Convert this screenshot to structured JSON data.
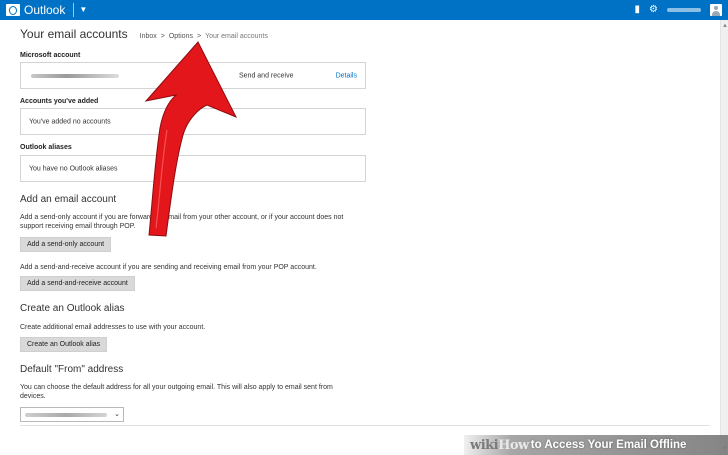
{
  "topbar": {
    "brand": "Outlook",
    "icons": [
      "chat-icon",
      "gear-icon",
      "avatar"
    ],
    "color": "#0072c6"
  },
  "page": {
    "title": "Your email accounts",
    "breadcrumb": [
      "Inbox",
      "Options",
      "Your email accounts"
    ],
    "breadcrumb_separator": ">"
  },
  "microsoft_account": {
    "label": "Microsoft account",
    "status": "Send and receive",
    "details_link": "Details"
  },
  "added_accounts": {
    "label": "Accounts you've added",
    "empty_text": "You've added no accounts"
  },
  "aliases": {
    "label": "Outlook aliases",
    "empty_text": "You have no Outlook aliases"
  },
  "add_account": {
    "heading": "Add an email account",
    "send_only_text": "Add a send-only account if you are forwarding email from your other account, or if your account does not support receiving email through POP.",
    "send_only_button": "Add a send-only account",
    "send_receive_text": "Add a send-and-receive account if you are sending and receiving email from your POP account.",
    "send_receive_button": "Add a send-and-receive account"
  },
  "create_alias": {
    "heading": "Create an Outlook alias",
    "text": "Create additional email addresses to use with your account.",
    "button": "Create an Outlook alias"
  },
  "default_from": {
    "heading": "Default \"From\" address",
    "text": "You can choose the default address for all your outgoing email. This will also apply to email sent from devices."
  },
  "watermark": {
    "logo_part1": "wiki",
    "logo_part2": "How",
    "text": "to Access Your Email Offline"
  },
  "annotation_color": "#e3161b"
}
